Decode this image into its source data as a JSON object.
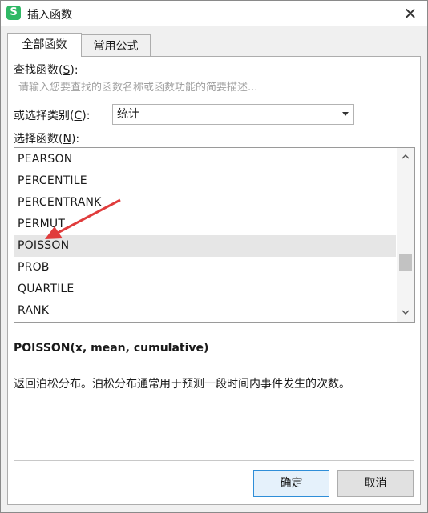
{
  "window": {
    "title": "插入函数",
    "app_icon_letter": "S",
    "close_glyph": "✕"
  },
  "tabs": [
    {
      "label": "全部函数",
      "active": true
    },
    {
      "label": "常用公式",
      "active": false
    }
  ],
  "search": {
    "label_prefix": "查找函数(",
    "label_key": "S",
    "label_suffix": "):",
    "placeholder": "请输入您要查找的函数名称或函数功能的简要描述..."
  },
  "category": {
    "label_prefix": "或选择类别(",
    "label_key": "C",
    "label_suffix": "):",
    "selected": "统计"
  },
  "function_list": {
    "label_prefix": "选择函数(",
    "label_key": "N",
    "label_suffix": "):",
    "items": [
      "PEARSON",
      "PERCENTILE",
      "PERCENTRANK",
      "PERMUT",
      "POISSON",
      "PROB",
      "QUARTILE",
      "RANK"
    ],
    "selected": "POISSON"
  },
  "details": {
    "signature": "POISSON(x, mean, cumulative)",
    "description": "返回泊松分布。泊松分布通常用于预测一段时间内事件发生的次数。"
  },
  "buttons": {
    "ok": "确定",
    "cancel": "取消"
  },
  "colors": {
    "annotation_arrow": "#e03c3c",
    "app_icon": "#2fb865",
    "ok_border": "#2f8ed8"
  }
}
